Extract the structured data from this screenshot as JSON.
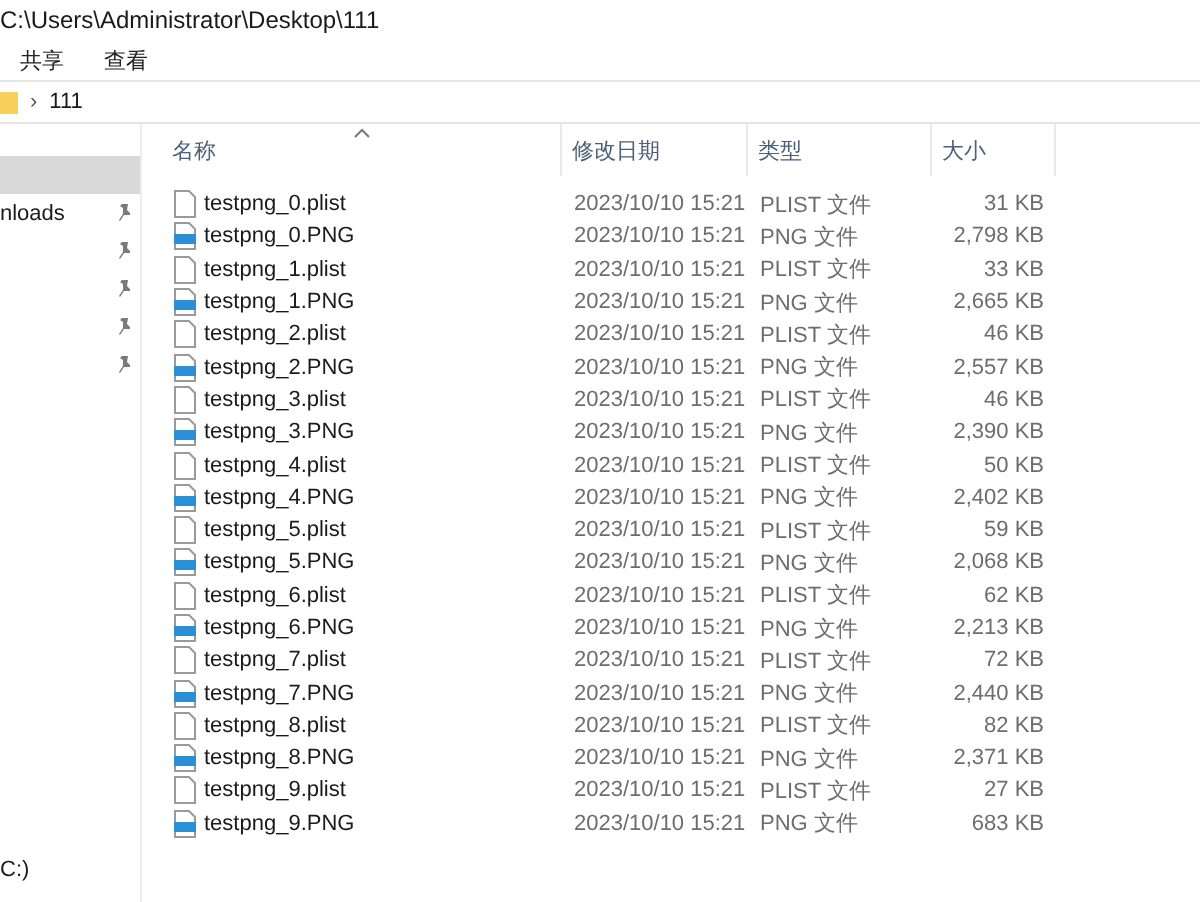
{
  "window": {
    "title": "C:\\Users\\Administrator\\Desktop\\111"
  },
  "ribbon_tabs": [
    {
      "label": "共享"
    },
    {
      "label": "查看"
    }
  ],
  "address_bar": {
    "separator": "›",
    "crumb": "111"
  },
  "sidebar": {
    "items": [
      {
        "selected": true,
        "pinned": false
      },
      {
        "label": "nloads",
        "selected": false,
        "pinned": true
      },
      {
        "selected": false,
        "pinned": true
      },
      {
        "selected": false,
        "pinned": true
      },
      {
        "selected": false,
        "pinned": true
      },
      {
        "selected": false,
        "pinned": true
      }
    ],
    "drives": [
      {
        "label": "C:)"
      }
    ]
  },
  "table": {
    "columns": [
      {
        "label": "名称",
        "sorted": true
      },
      {
        "label": "修改日期",
        "sorted": false
      },
      {
        "label": "类型",
        "sorted": false
      },
      {
        "label": "大小",
        "sorted": false
      }
    ],
    "rows": [
      {
        "kind": "plist",
        "name": "testpng_0.plist",
        "modified": "2023/10/10 15:21",
        "type": "PLIST 文件",
        "size": "31 KB"
      },
      {
        "kind": "png",
        "name": "testpng_0.PNG",
        "modified": "2023/10/10 15:21",
        "type": "PNG 文件",
        "size": "2,798 KB"
      },
      {
        "kind": "plist",
        "name": "testpng_1.plist",
        "modified": "2023/10/10 15:21",
        "type": "PLIST 文件",
        "size": "33 KB"
      },
      {
        "kind": "png",
        "name": "testpng_1.PNG",
        "modified": "2023/10/10 15:21",
        "type": "PNG 文件",
        "size": "2,665 KB"
      },
      {
        "kind": "plist",
        "name": "testpng_2.plist",
        "modified": "2023/10/10 15:21",
        "type": "PLIST 文件",
        "size": "46 KB"
      },
      {
        "kind": "png",
        "name": "testpng_2.PNG",
        "modified": "2023/10/10 15:21",
        "type": "PNG 文件",
        "size": "2,557 KB"
      },
      {
        "kind": "plist",
        "name": "testpng_3.plist",
        "modified": "2023/10/10 15:21",
        "type": "PLIST 文件",
        "size": "46 KB"
      },
      {
        "kind": "png",
        "name": "testpng_3.PNG",
        "modified": "2023/10/10 15:21",
        "type": "PNG 文件",
        "size": "2,390 KB"
      },
      {
        "kind": "plist",
        "name": "testpng_4.plist",
        "modified": "2023/10/10 15:21",
        "type": "PLIST 文件",
        "size": "50 KB"
      },
      {
        "kind": "png",
        "name": "testpng_4.PNG",
        "modified": "2023/10/10 15:21",
        "type": "PNG 文件",
        "size": "2,402 KB"
      },
      {
        "kind": "plist",
        "name": "testpng_5.plist",
        "modified": "2023/10/10 15:21",
        "type": "PLIST 文件",
        "size": "59 KB"
      },
      {
        "kind": "png",
        "name": "testpng_5.PNG",
        "modified": "2023/10/10 15:21",
        "type": "PNG 文件",
        "size": "2,068 KB"
      },
      {
        "kind": "plist",
        "name": "testpng_6.plist",
        "modified": "2023/10/10 15:21",
        "type": "PLIST 文件",
        "size": "62 KB"
      },
      {
        "kind": "png",
        "name": "testpng_6.PNG",
        "modified": "2023/10/10 15:21",
        "type": "PNG 文件",
        "size": "2,213 KB"
      },
      {
        "kind": "plist",
        "name": "testpng_7.plist",
        "modified": "2023/10/10 15:21",
        "type": "PLIST 文件",
        "size": "72 KB"
      },
      {
        "kind": "png",
        "name": "testpng_7.PNG",
        "modified": "2023/10/10 15:21",
        "type": "PNG 文件",
        "size": "2,440 KB"
      },
      {
        "kind": "plist",
        "name": "testpng_8.plist",
        "modified": "2023/10/10 15:21",
        "type": "PLIST 文件",
        "size": "82 KB"
      },
      {
        "kind": "png",
        "name": "testpng_8.PNG",
        "modified": "2023/10/10 15:21",
        "type": "PNG 文件",
        "size": "2,371 KB"
      },
      {
        "kind": "plist",
        "name": "testpng_9.plist",
        "modified": "2023/10/10 15:21",
        "type": "PLIST 文件",
        "size": "27 KB"
      },
      {
        "kind": "png",
        "name": "testpng_9.PNG",
        "modified": "2023/10/10 15:21",
        "type": "PNG 文件",
        "size": "683 KB"
      }
    ]
  }
}
